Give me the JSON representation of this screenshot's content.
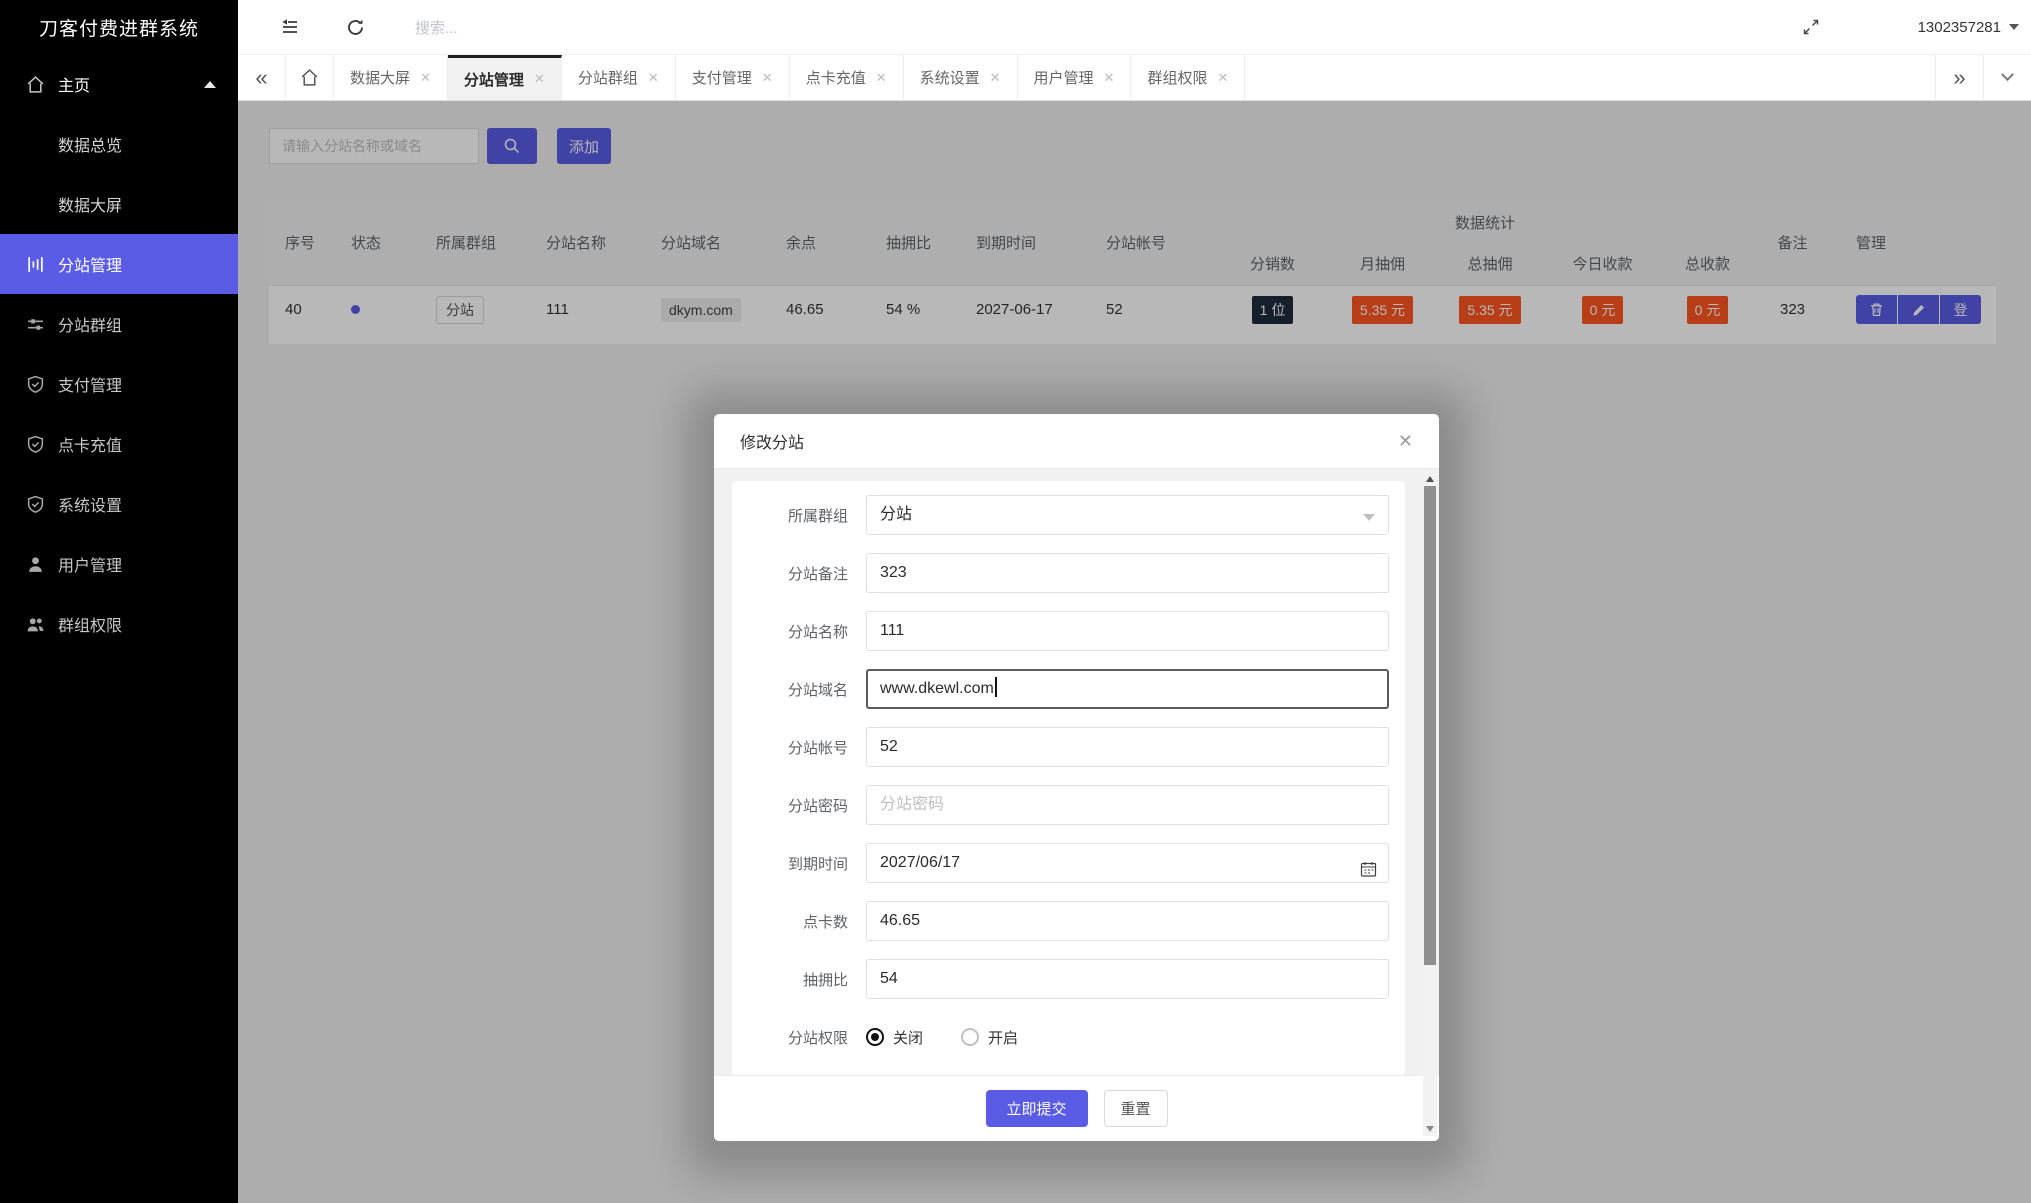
{
  "colors": {
    "primary": "#5a5ce6",
    "badge_dark": "#1f2d3d",
    "badge_red": "#ff5722"
  },
  "sidebar": {
    "title": "刀客付费进群系统",
    "items": [
      {
        "label": "主页"
      },
      {
        "label": "数据总览"
      },
      {
        "label": "数据大屏"
      },
      {
        "label": "分站管理"
      },
      {
        "label": "分站群组"
      },
      {
        "label": "支付管理"
      },
      {
        "label": "点卡充值"
      },
      {
        "label": "系统设置"
      },
      {
        "label": "用户管理"
      },
      {
        "label": "群组权限"
      }
    ]
  },
  "topbar": {
    "search_placeholder": "搜索...",
    "user_id": "1302357281"
  },
  "tabbar": {
    "tabs": [
      {
        "label": "数据大屏"
      },
      {
        "label": "分站管理"
      },
      {
        "label": "分站群组"
      },
      {
        "label": "支付管理"
      },
      {
        "label": "点卡充值"
      },
      {
        "label": "系统设置"
      },
      {
        "label": "用户管理"
      },
      {
        "label": "群组权限"
      }
    ]
  },
  "toolbar": {
    "search_placeholder": "请输入分站名称或域名",
    "add_label": "添加"
  },
  "table": {
    "headers": {
      "index": "序号",
      "status": "状态",
      "group": "所属群组",
      "site_name": "分站名称",
      "site_domain": "分站域名",
      "balance": "余点",
      "commission_rate": "抽拥比",
      "expire_time": "到期时间",
      "site_account": "分站帐号",
      "stats_group": "数据统计",
      "distributors": "分销数",
      "month_commission": "月抽佣",
      "total_commission": "总抽佣",
      "today_income": "今日收款",
      "total_income": "总收款",
      "remark": "备注",
      "manage": "管理"
    },
    "row": {
      "index": "40",
      "group_tag": "分站",
      "site_name": "111",
      "site_domain": "dkym.com",
      "balance": "46.65",
      "commission_rate": "54 %",
      "expire_time": "2027-06-17",
      "site_account": "52",
      "distributors": "1 位",
      "month_commission": "5.35 元",
      "total_commission": "5.35 元",
      "today_income": "0 元",
      "total_income": "0 元",
      "remark": "323",
      "login_label": "登"
    }
  },
  "modal": {
    "title": "修改分站",
    "fields": [
      {
        "label": "所属群组",
        "value": "分站"
      },
      {
        "label": "分站备注",
        "value": "323"
      },
      {
        "label": "分站名称",
        "value": "111"
      },
      {
        "label": "分站域名",
        "value": "www.dkewl.com"
      },
      {
        "label": "分站帐号",
        "value": "52"
      },
      {
        "label": "分站密码",
        "placeholder": "分站密码"
      },
      {
        "label": "到期时间",
        "value": "2027/06/17"
      },
      {
        "label": "点卡数",
        "value": "46.65"
      },
      {
        "label": "抽拥比",
        "value": "54"
      },
      {
        "label": "分站权限",
        "options": [
          {
            "label": "关闭"
          },
          {
            "label": "开启"
          }
        ]
      }
    ],
    "submit_label": "立即提交",
    "reset_label": "重置"
  }
}
